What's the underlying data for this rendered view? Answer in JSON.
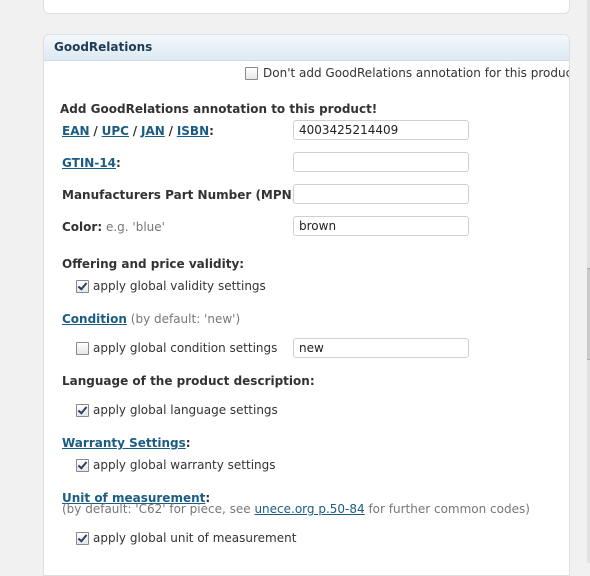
{
  "panel_title": "GoodRelations",
  "dont_add": {
    "label": "Don't add GoodRelations annotation for this product.",
    "checked": false
  },
  "section_heading": "Add GoodRelations annotation to this product!",
  "ids": {
    "ean": "EAN",
    "upc": "UPC",
    "jan": "JAN",
    "isbn": "ISBN",
    "sep": "/",
    "colon": ":",
    "value": "4003425214409"
  },
  "gtin": {
    "label": "GTIN-14",
    "colon": ":",
    "value": ""
  },
  "mpn": {
    "label": "Manufacturers Part Number (MPN):",
    "value": ""
  },
  "color": {
    "label": "Color:",
    "hint": "e.g. 'blue'",
    "value": "brown"
  },
  "validity": {
    "label": "Offering and price validity:",
    "option": "apply global validity settings",
    "checked": true
  },
  "condition": {
    "label": "Condition",
    "hint": "(by default: 'new')",
    "option": "apply global condition settings",
    "checked": false,
    "value": "new"
  },
  "language": {
    "label": "Language of the product description:",
    "option": "apply global language settings",
    "checked": true
  },
  "warranty": {
    "label": "Warranty Settings",
    "colon": ":",
    "option": "apply global warranty settings",
    "checked": true
  },
  "unit": {
    "label": "Unit of measurement",
    "colon": ":",
    "hint_pre": "(by default: 'C62' for piece, see ",
    "hint_link": "unece.org p.50-84",
    "hint_post": " for further common codes)",
    "option": "apply global unit of measurement",
    "checked": true
  }
}
